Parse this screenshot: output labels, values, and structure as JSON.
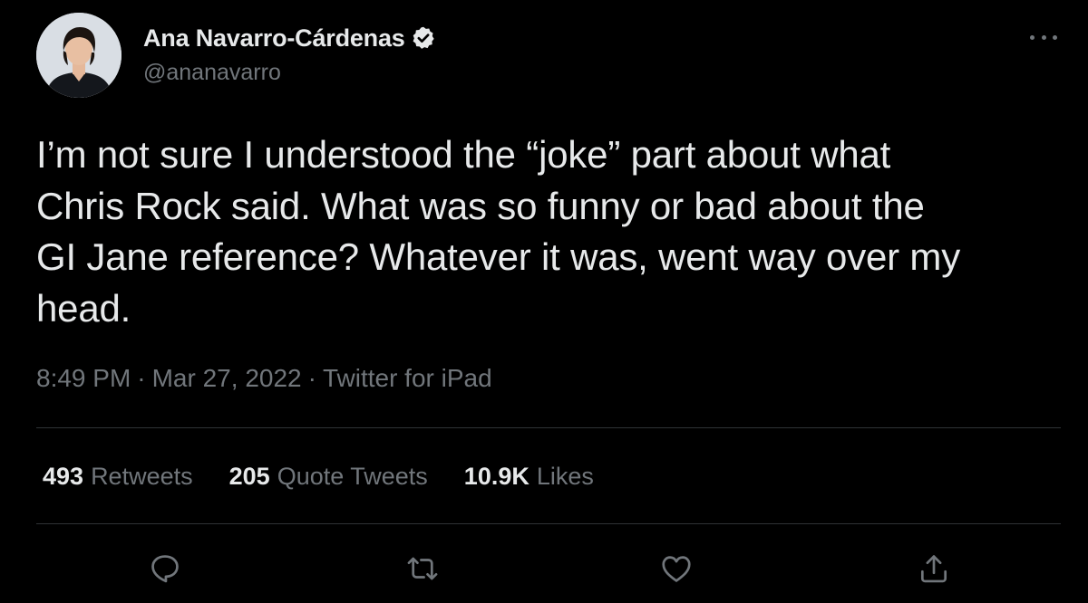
{
  "author": {
    "name": "Ana Navarro-Cárdenas",
    "handle": "@ananavarro",
    "verified": true
  },
  "tweet": {
    "text": "I’m not sure I understood the “joke” part about what\nChris Rock said. What was so funny or bad about the\nGI Jane reference? Whatever it was, went way over my\nhead."
  },
  "meta": {
    "time": "8:49 PM",
    "separator": "·",
    "date": "Mar 27, 2022",
    "source": "Twitter for iPad"
  },
  "stats": {
    "retweets_count": "493",
    "retweets_label": "Retweets",
    "quotes_count": "205",
    "quotes_label": "Quote Tweets",
    "likes_count": "10.9K",
    "likes_label": "Likes"
  },
  "actions": [
    "reply-icon",
    "retweet-icon",
    "like-icon",
    "share-icon"
  ],
  "colors": {
    "background": "#000000",
    "text_primary": "#e7e9ea",
    "text_secondary": "#71767b",
    "divider": "#2f3336",
    "verified_badge": "#e7e9ea"
  }
}
